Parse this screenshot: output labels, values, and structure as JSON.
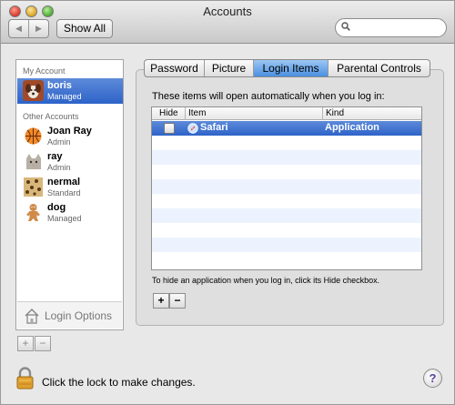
{
  "window": {
    "title": "Accounts"
  },
  "toolbar": {
    "back": "◀",
    "forward": "▶",
    "show_all": "Show All",
    "search_value": ""
  },
  "sidebar": {
    "my_account_header": "My Account",
    "other_accounts_header": "Other Accounts",
    "accounts": [
      {
        "name": "boris",
        "role": "Managed",
        "selected": true,
        "pic": "dog-photo"
      },
      {
        "name": "Joan Ray",
        "role": "Admin",
        "selected": false,
        "pic": "basketball"
      },
      {
        "name": "ray",
        "role": "Admin",
        "selected": false,
        "pic": "cat"
      },
      {
        "name": "nermal",
        "role": "Standard",
        "selected": false,
        "pic": "leopard"
      },
      {
        "name": "dog",
        "role": "Managed",
        "selected": false,
        "pic": "gingerbread"
      }
    ],
    "login_options": "Login Options",
    "add": "+",
    "remove": "−"
  },
  "tabs": [
    {
      "label": "Password",
      "active": false
    },
    {
      "label": "Picture",
      "active": false
    },
    {
      "label": "Login Items",
      "active": true
    },
    {
      "label": "Parental Controls",
      "active": false
    }
  ],
  "login_items": {
    "intro": "These items will open automatically when you log in:",
    "columns": [
      "Hide",
      "Item",
      "Kind"
    ],
    "rows": [
      {
        "hide": false,
        "item": "Safari",
        "kind": "Application",
        "icon": "safari-compass"
      }
    ],
    "hint": "To hide an application when you log in, click its Hide checkbox.",
    "add": "+",
    "remove": "−"
  },
  "footer": {
    "lock_text": "Click the lock to make changes.",
    "help": "?"
  },
  "colors": {
    "selection": "#3a6fd3",
    "active_tab": "#6aa7ec",
    "row_alt": "#edf3fe"
  }
}
